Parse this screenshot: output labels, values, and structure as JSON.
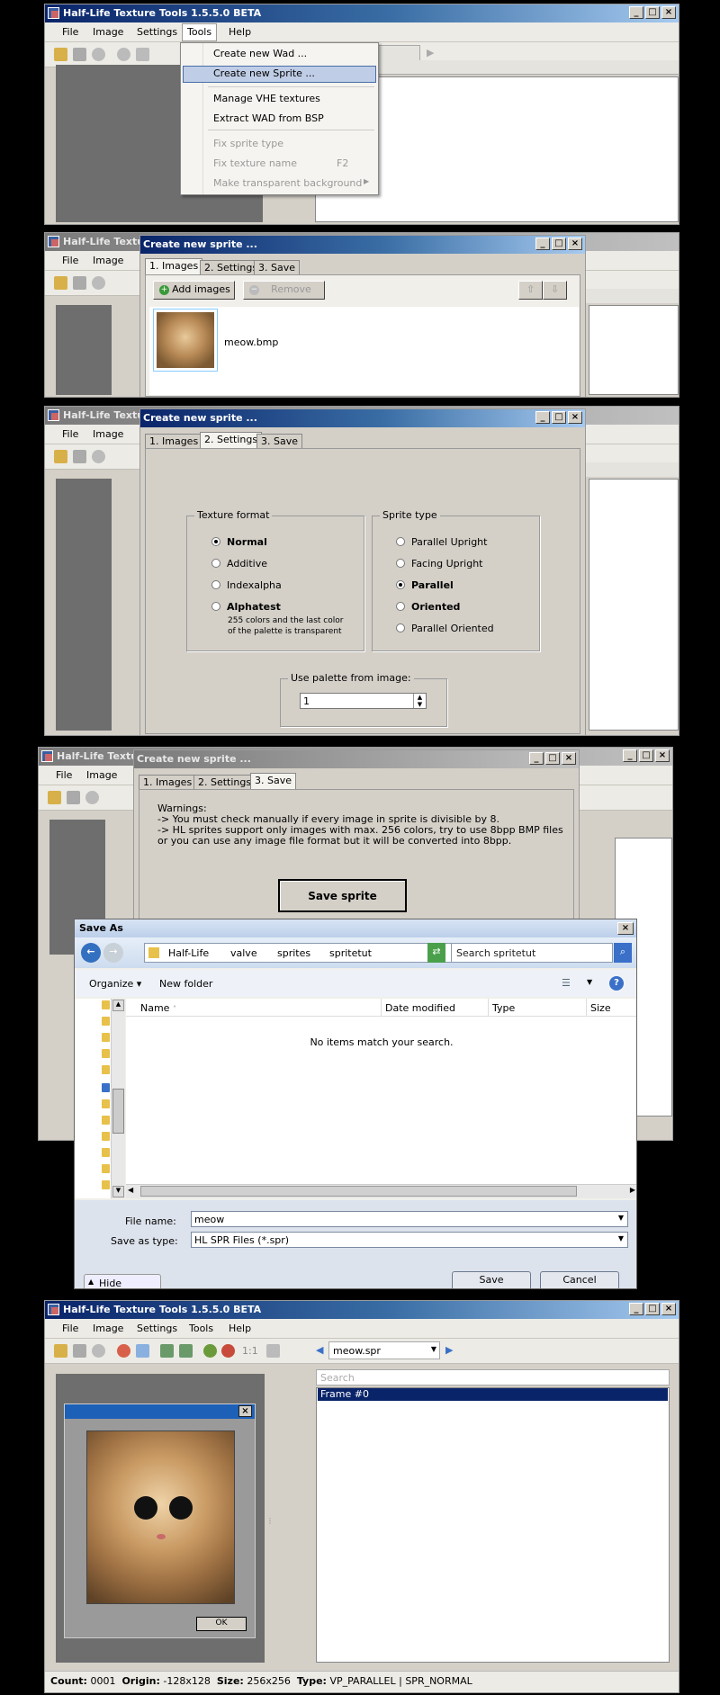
{
  "app": {
    "title": "Half-Life Texture Tools 1.5.5.0 BETA",
    "title_short": "Half-Life Textu",
    "menu": [
      "File",
      "Image",
      "Settings",
      "Tools",
      "Help"
    ]
  },
  "tools_menu": {
    "items": [
      "Create new Wad ...",
      "Create new Sprite ...",
      "Manage VHE textures",
      "Extract WAD from BSP",
      "Fix sprite type",
      "Fix texture name",
      "Make transparent background"
    ],
    "fix_texture_shortcut": "F2"
  },
  "sprite_dialog": {
    "title": "Create new sprite ...",
    "tabs": [
      "1. Images",
      "2. Settings",
      "3. Save"
    ],
    "add_images": "Add images",
    "remove": "Remove",
    "image_file": "meow.bmp"
  },
  "settings": {
    "texture_format_label": "Texture format",
    "texture_formats": [
      "Normal",
      "Additive",
      "Indexalpha",
      "Alphatest"
    ],
    "alphatest_note_1": "255 colors and the last color",
    "alphatest_note_2": "of the palette is transparent",
    "sprite_type_label": "Sprite type",
    "sprite_types": [
      "Parallel Upright",
      "Facing Upright",
      "Parallel",
      "Oriented",
      "Parallel Oriented"
    ],
    "palette_label": "Use palette from image:",
    "palette_value": "1"
  },
  "save_tab": {
    "warnings_1": "Warnings:",
    "warnings_2": "-> You must check manually if every image in sprite is divisible by 8.",
    "warnings_3": "-> HL sprites support only images with max. 256 colors, try to use 8bpp BMP files",
    "warnings_4": "or you can use any image file format but it will be converted into 8bpp.",
    "save_sprite": "Save sprite"
  },
  "save_as": {
    "title": "Save As",
    "breadcrumb": [
      "Half-Life",
      "valve",
      "sprites",
      "spritetut"
    ],
    "search_placeholder": "Search spritetut",
    "organize": "Organize",
    "new_folder": "New folder",
    "columns": [
      "Name",
      "Date modified",
      "Type",
      "Size"
    ],
    "empty_msg": "No items match your search.",
    "file_name_label": "File name:",
    "file_name_value": "meow",
    "save_type_label": "Save as type:",
    "save_type_value": "HL SPR Files (*.spr)",
    "save": "Save",
    "cancel": "Cancel",
    "hide_folders": "Hide Folders"
  },
  "final": {
    "dropdown_value": "meow.spr",
    "search_placeholder": "Search",
    "list_items": [
      "Frame #0"
    ],
    "preview_ok": "OK",
    "zoom_label": "1:1",
    "status": {
      "count_label": "Count:",
      "count": "0001",
      "origin_label": "Origin:",
      "origin": "-128x128",
      "size_label": "Size:",
      "size": "256x256",
      "type_label": "Type:",
      "type": "VP_PARALLEL | SPR_NORMAL"
    }
  }
}
